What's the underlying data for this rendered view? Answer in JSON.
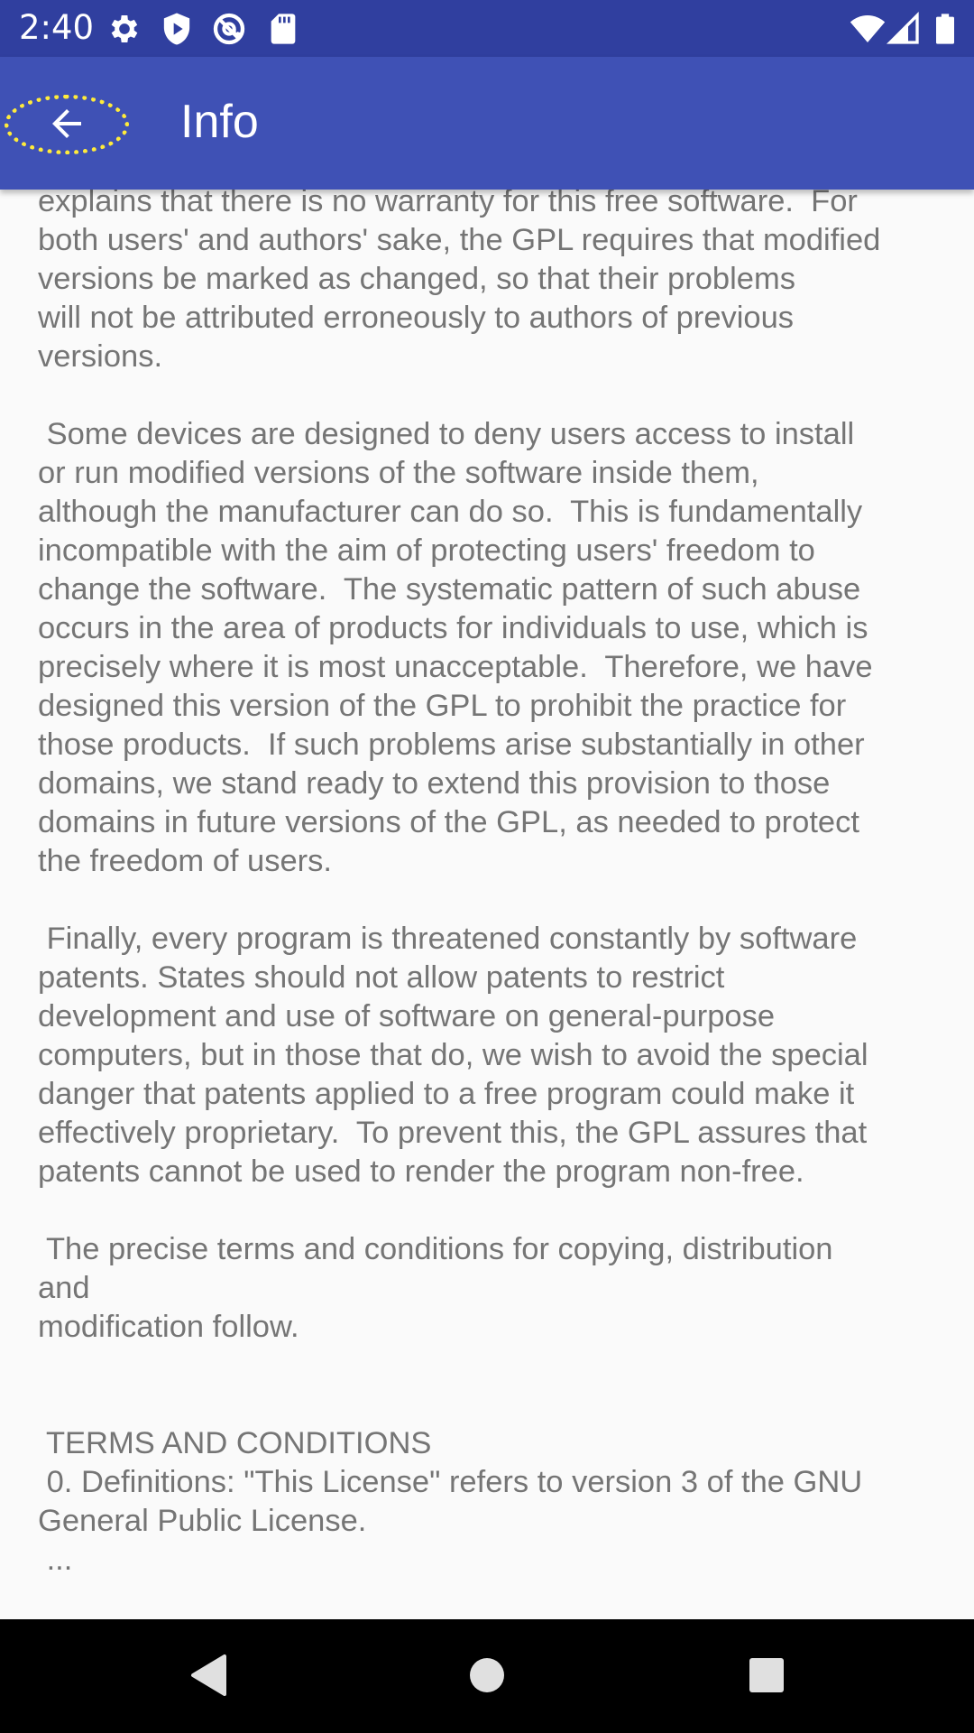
{
  "status_bar": {
    "time": "2:40",
    "left_icons": [
      "gear-icon",
      "shield-play-icon",
      "at-sign-icon",
      "sd-card-icon"
    ],
    "right_icons": [
      "wifi-icon",
      "signal-icon",
      "battery-icon"
    ]
  },
  "app_bar": {
    "title": "Info",
    "back_icon": "arrow-back-icon",
    "background": "#3f51b5",
    "status_background": "#303f9f",
    "highlight_color": "#ffeb3b"
  },
  "content": {
    "lines": [
      "explains that there is no warranty for this free software.  For",
      "both users' and authors' sake, the GPL requires that modified",
      "versions be marked as changed, so that their problems",
      "will not be attributed erroneously to authors of previous",
      "versions.",
      "",
      " Some devices are designed to deny users access to install",
      "or run modified versions of the software inside them,",
      "although the manufacturer can do so.  This is fundamentally",
      "incompatible with the aim of protecting users' freedom to",
      "change the software.  The systematic pattern of such abuse",
      "occurs in the area of products for individuals to use, which is",
      "precisely where it is most unacceptable.  Therefore, we have",
      "designed this version of the GPL to prohibit the practice for",
      "those products.  If such problems arise substantially in other",
      "domains, we stand ready to extend this provision to those",
      "domains in future versions of the GPL, as needed to protect",
      "the freedom of users.",
      "",
      " Finally, every program is threatened constantly by software",
      "patents. States should not allow patents to restrict",
      "development and use of software on general-purpose",
      "computers, but in those that do, we wish to avoid the special",
      "danger that patents applied to a free program could make it",
      "effectively proprietary.  To prevent this, the GPL assures that",
      "patents cannot be used to render the program non-free.",
      "",
      " The precise terms and conditions for copying, distribution",
      "and",
      "modification follow.",
      "",
      "",
      " TERMS AND CONDITIONS",
      " 0. Definitions: \"This License\" refers to version 3 of the GNU",
      "General Public License.",
      " ..."
    ],
    "text_color": "#757575"
  },
  "nav_bar": {
    "buttons": [
      "back-triangle-icon",
      "home-circle-icon",
      "recents-square-icon"
    ]
  }
}
